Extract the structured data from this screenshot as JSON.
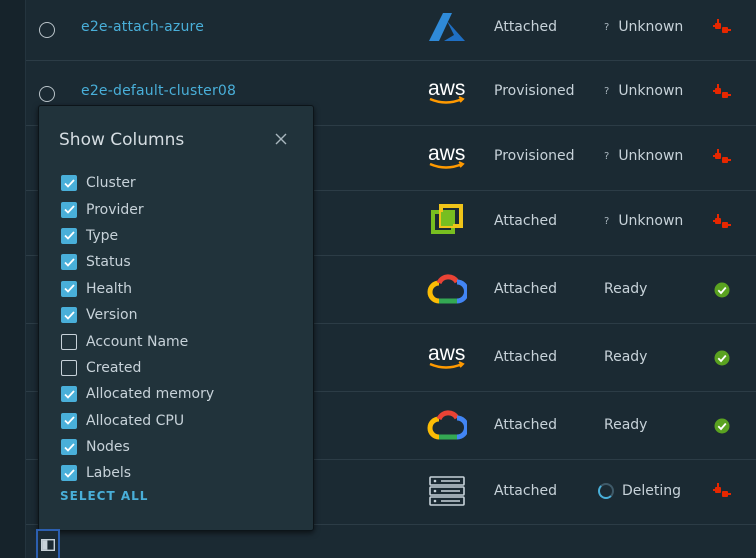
{
  "rows": [
    {
      "name": "e2e-attach-azure",
      "provider_icon": "azure-icon",
      "type": "Attached",
      "status": "Unknown",
      "status_mark": "?",
      "health_icon": "disconnected-plug-icon"
    },
    {
      "name": "e2e-default-cluster08",
      "provider_icon": "aws-icon",
      "type": "Provisioned",
      "status": "Unknown",
      "status_mark": "?",
      "health_icon": "disconnected-plug-icon"
    },
    {
      "name": "",
      "provider_icon": "aws-icon",
      "type": "Provisioned",
      "status": "Unknown",
      "status_mark": "?",
      "health_icon": "disconnected-plug-icon"
    },
    {
      "name": "",
      "provider_icon": "vsphere-icon",
      "type": "Attached",
      "status": "Unknown",
      "status_mark": "?",
      "health_icon": "disconnected-plug-icon"
    },
    {
      "name": "",
      "provider_icon": "google-cloud-icon",
      "type": "Attached",
      "status": "Ready",
      "status_mark": "",
      "health_icon": "healthy-check-icon"
    },
    {
      "name": "",
      "provider_icon": "aws-icon",
      "type": "Attached",
      "status": "Ready",
      "status_mark": "",
      "health_icon": "healthy-check-icon"
    },
    {
      "name": "",
      "provider_icon": "google-cloud-icon",
      "type": "Attached",
      "status": "Ready",
      "status_mark": "",
      "health_icon": "healthy-check-icon"
    },
    {
      "name": "",
      "provider_icon": "server-icon",
      "type": "Attached",
      "status": "Deleting",
      "status_mark": "",
      "health_icon": "disconnected-plug-icon"
    }
  ],
  "aws_text": "aws",
  "column_picker": {
    "title": "Show Columns",
    "select_all": "SELECT ALL",
    "options": [
      {
        "label": "Cluster",
        "checked": true
      },
      {
        "label": "Provider",
        "checked": true
      },
      {
        "label": "Type",
        "checked": true
      },
      {
        "label": "Status",
        "checked": true
      },
      {
        "label": "Health",
        "checked": true
      },
      {
        "label": "Version",
        "checked": true
      },
      {
        "label": "Account Name",
        "checked": false
      },
      {
        "label": "Created",
        "checked": false
      },
      {
        "label": "Allocated memory",
        "checked": true
      },
      {
        "label": "Allocated CPU",
        "checked": true
      },
      {
        "label": "Nodes",
        "checked": true
      },
      {
        "label": "Labels",
        "checked": true
      }
    ]
  },
  "colors": {
    "accent": "#49afd9",
    "healthy": "#5aa220",
    "error": "#e62700",
    "background": "#1b2a33"
  }
}
